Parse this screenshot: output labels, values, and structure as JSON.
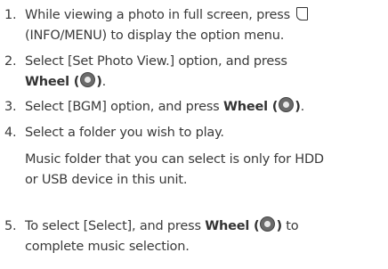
{
  "steps": [
    {
      "number": "1.",
      "line1_pre": "While viewing a photo in full screen, press",
      "line1_icon": "info-menu-icon",
      "line2": "(INFO/MENU) to display the option menu."
    },
    {
      "number": "2.",
      "line1": "Select [Set Photo View.] option, and press",
      "bold": "Wheel (",
      "bold_close": ")",
      "after": "."
    },
    {
      "number": "3.",
      "pre": "Select [BGM] option, and press ",
      "bold": "Wheel (",
      "bold_close": ")",
      "after": "."
    },
    {
      "number": "4.",
      "line1": "Select a folder you wish to play.",
      "note_line1": "Music folder that you can select is only for HDD",
      "note_line2": "or USB device in this unit."
    },
    {
      "number": "5.",
      "pre": "To select [Select], and press ",
      "bold": "Wheel (",
      "bold_close": ")",
      "post": " to",
      "line2": "complete music selection."
    }
  ],
  "icons": {
    "wheel": "wheel-icon",
    "info_menu": "info-menu-icon"
  }
}
